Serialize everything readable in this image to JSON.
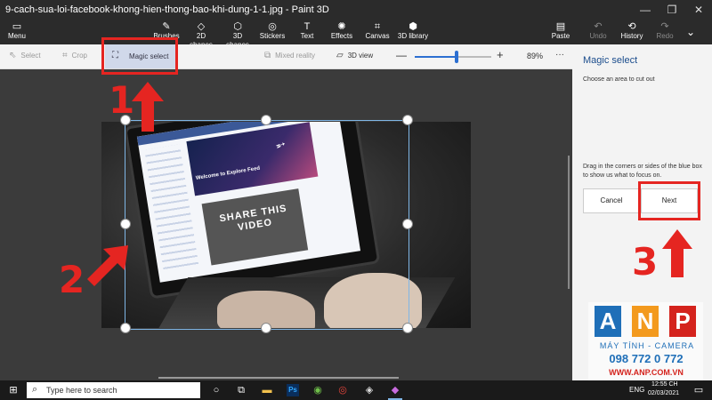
{
  "window": {
    "title": "9-cach-sua-loi-facebook-khong-hien-thong-bao-khi-dung-1-1.jpg - Paint 3D"
  },
  "ribbon": {
    "menu": "Menu",
    "brushes": "Brushes",
    "shapes2d": "2D shapes",
    "shapes3d": "3D shapes",
    "stickers": "Stickers",
    "text": "Text",
    "effects": "Effects",
    "canvas": "Canvas",
    "library3d": "3D library",
    "paste": "Paste",
    "undo": "Undo",
    "history": "History",
    "redo": "Redo"
  },
  "toolbar": {
    "select": "Select",
    "crop": "Crop",
    "magic_select": "Magic select",
    "mixed_reality": "Mixed reality",
    "view3d": "3D view",
    "zoom": "89%",
    "zoom_fraction": 0.55,
    "more": "···"
  },
  "panel": {
    "title": "Magic select",
    "subtitle": "Choose an area to cut out",
    "instruction": "Drag in the corners or sides of the blue box to show us what to focus on.",
    "cancel": "Cancel",
    "next": "Next"
  },
  "annotations": {
    "step1": "1",
    "step2": "2",
    "step3": "3"
  },
  "photo": {
    "screen_title": "Welcome to Explore Feed",
    "video_text": "SHARE THIS VIDEO"
  },
  "logo": {
    "l1": "A",
    "l2": "N",
    "l3": "P",
    "line1": "MÁY TÍNH - CAMERA",
    "line2": "098 772 0 772",
    "line3": "WWW.ANP.COM.VN"
  },
  "taskbar": {
    "search_placeholder": "Type here to search",
    "lang": "ENG",
    "time": "12:55 CH",
    "date": "02/03/2021"
  },
  "colors": {
    "annotation_red": "#e52521",
    "logo_blue": "#1f6fb8",
    "logo_orange": "#f39a1e",
    "logo_red": "#d4231d"
  }
}
